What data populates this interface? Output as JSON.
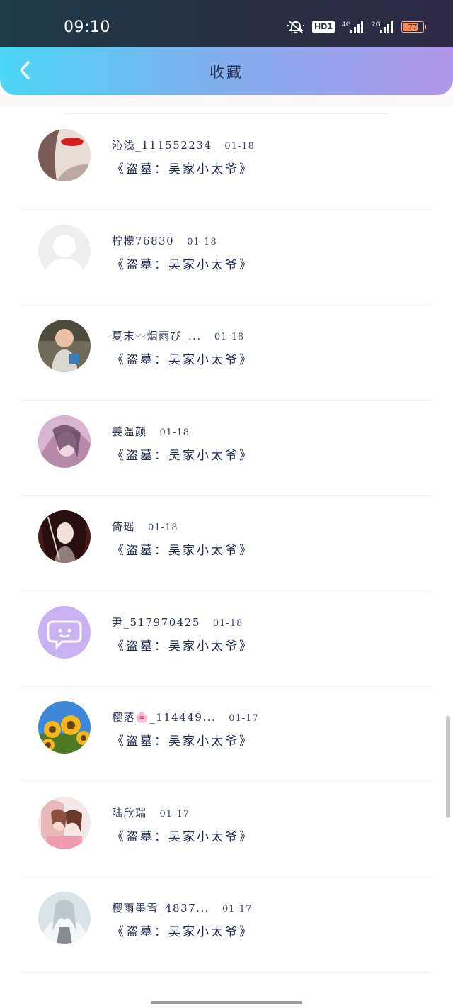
{
  "status_bar": {
    "time": "09:10",
    "hd_label": "HD1",
    "net1_label": "4G",
    "net2_label": "2G",
    "battery_level": "77",
    "battery_color": "#f08a5d"
  },
  "header": {
    "title": "收藏",
    "back_icon": "chevron-left-icon",
    "gradient": [
      "#4cd6f5",
      "#b296ec"
    ]
  },
  "list": {
    "items": [
      {
        "user": "沁浅_111552234",
        "date": "01-18",
        "work": "《盗墓：吴家小太爷》",
        "avatar": "photo-red-lips"
      },
      {
        "user": "柠檬76830",
        "date": "01-18",
        "work": "《盗墓：吴家小太爷》",
        "avatar": "default-person"
      },
      {
        "user": "夏末〰烟雨ぴ_...",
        "date": "01-18",
        "work": "《盗墓：吴家小太爷》",
        "avatar": "photo-baby"
      },
      {
        "user": "姜温颜",
        "date": "01-18",
        "work": "《盗墓：吴家小太爷》",
        "avatar": "anime-pink"
      },
      {
        "user": "倚瑶",
        "date": "01-18",
        "work": "《盗墓：吴家小太爷》",
        "avatar": "anime-dark"
      },
      {
        "user": "尹_517970425",
        "date": "01-18",
        "work": "《盗墓：吴家小太爷》",
        "avatar": "chat-bubble-purple"
      },
      {
        "user": "樱落🌸_114449...",
        "date": "01-17",
        "work": "《盗墓：吴家小太爷》",
        "avatar": "sunflowers"
      },
      {
        "user": "陆欣瑞",
        "date": "01-17",
        "work": "《盗墓：吴家小太爷》",
        "avatar": "anime-couple"
      },
      {
        "user": "樱雨墨雪_4837...",
        "date": "01-17",
        "work": "《盗墓：吴家小太爷》",
        "avatar": "anime-white"
      }
    ]
  }
}
